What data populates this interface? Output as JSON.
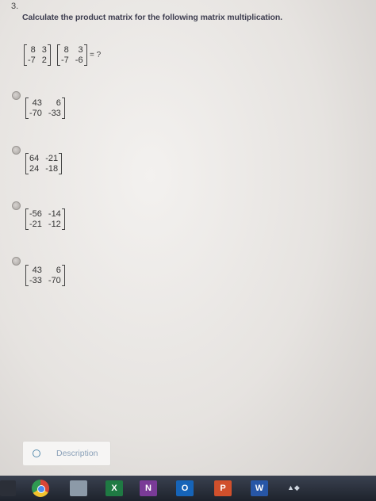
{
  "question": {
    "number": "3.",
    "text": "Calculate the product matrix for the following matrix multiplication.",
    "matrix_a": [
      "8",
      "3",
      "-7",
      "2"
    ],
    "matrix_b": [
      "8",
      "3",
      "-7",
      "-6"
    ],
    "equals": "= ?"
  },
  "options": [
    {
      "values": [
        "43",
        "6",
        "-70",
        "-33"
      ]
    },
    {
      "values": [
        "64",
        "-21",
        "24",
        "-18"
      ]
    },
    {
      "values": [
        "-56",
        "-14",
        "-21",
        "-12"
      ]
    },
    {
      "values": [
        "43",
        "6",
        "-33",
        "-70"
      ]
    }
  ],
  "description_button": {
    "label": "Description"
  },
  "taskbar": {
    "icons": [
      "windows-icon",
      "chrome-icon",
      "file-explorer-icon",
      "excel-icon",
      "onenote-icon",
      "outlook-icon",
      "powerpoint-icon",
      "word-icon"
    ],
    "excel_letter": "X",
    "onenote_letter": "N",
    "outlook_letter": "O",
    "powerpoint_letter": "P",
    "word_letter": "W"
  }
}
